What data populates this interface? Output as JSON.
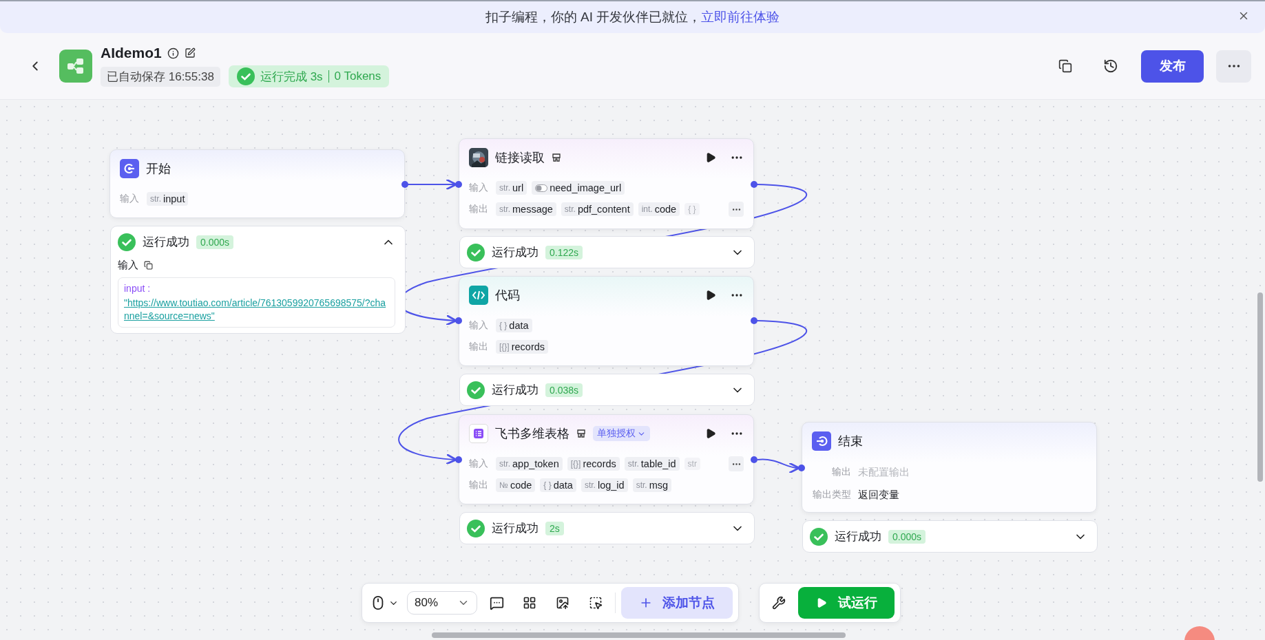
{
  "banner": {
    "text": "扣子编程，你的 AI 开发伙伴已就位，",
    "link": "立即前往体验"
  },
  "header": {
    "title": "AIdemo1",
    "autosave": "已自动保存 16:55:38",
    "run_status": "运行完成 3s",
    "tokens": "0 Tokens",
    "publish": "发布"
  },
  "nodes": [
    {
      "kind": "start",
      "title": "开始",
      "rows": [
        {
          "label": "输入",
          "params": [
            {
              "kind": "typed",
              "type": "str.",
              "name": "input"
            }
          ]
        }
      ],
      "result": {
        "status": "运行成功",
        "time": "0.000s",
        "expanded": true,
        "section": "输入",
        "key": "input :",
        "value": "\"https://www.toutiao.com/article/7613059920765698575/?channel=&source=news\""
      }
    },
    {
      "kind": "plugin",
      "title": "链接读取",
      "rows": [
        {
          "label": "输入",
          "params": [
            {
              "kind": "typed",
              "type": "str.",
              "name": "url"
            },
            {
              "kind": "toggle",
              "name": "need_image_url"
            }
          ]
        },
        {
          "label": "输出",
          "params": [
            {
              "kind": "typed",
              "type": "str.",
              "name": "message"
            },
            {
              "kind": "typed",
              "type": "str.",
              "name": "pdf_content"
            },
            {
              "kind": "typed",
              "type": "int.",
              "name": "code"
            },
            {
              "kind": "typed",
              "type": "{ }",
              "faded": true
            }
          ],
          "more": true
        }
      ],
      "result": {
        "status": "运行成功",
        "time": "0.122s",
        "expanded": false
      }
    },
    {
      "kind": "code",
      "title": "代码",
      "rows": [
        {
          "label": "输入",
          "params": [
            {
              "kind": "typed",
              "type": "{ }",
              "name": "data"
            }
          ]
        },
        {
          "label": "输出",
          "params": [
            {
              "kind": "typed",
              "type": "[{}]",
              "name": "records"
            }
          ]
        }
      ],
      "result": {
        "status": "运行成功",
        "time": "0.038s",
        "expanded": false
      }
    },
    {
      "kind": "table",
      "title": "飞书多维表格",
      "auth": "单独授权",
      "rows": [
        {
          "label": "输入",
          "params": [
            {
              "kind": "typed",
              "type": "str.",
              "name": "app_token"
            },
            {
              "kind": "typed",
              "type": "[{}]",
              "name": "records"
            },
            {
              "kind": "typed",
              "type": "str.",
              "name": "table_id"
            },
            {
              "kind": "typed",
              "type": "str",
              "faded": true
            }
          ],
          "more": true
        },
        {
          "label": "输出",
          "params": [
            {
              "kind": "typed",
              "type": "№",
              "name": "code"
            },
            {
              "kind": "typed",
              "type": "{ }",
              "name": "data"
            },
            {
              "kind": "typed",
              "type": "str.",
              "name": "log_id"
            },
            {
              "kind": "typed",
              "type": "str.",
              "name": "msg"
            }
          ]
        }
      ],
      "result": {
        "status": "运行成功",
        "time": "2s",
        "expanded": false
      }
    },
    {
      "kind": "end",
      "title": "结束",
      "fields": [
        {
          "label": "输出",
          "placeholder": "未配置输出"
        },
        {
          "label": "输出类型",
          "value": "返回变量"
        }
      ],
      "result": {
        "status": "运行成功",
        "time": "0.000s",
        "expanded": false
      }
    }
  ],
  "toolbar": {
    "zoom": "80%",
    "add_node": "添加节点",
    "test_run": "试运行"
  }
}
